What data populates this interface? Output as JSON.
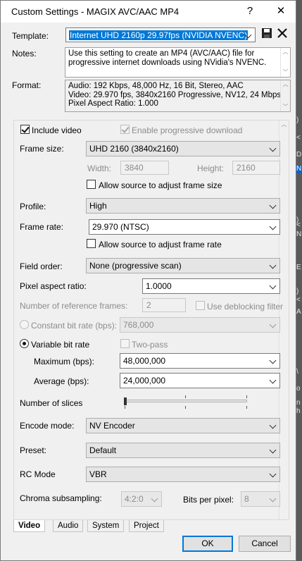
{
  "window": {
    "title": "Custom Settings - MAGIX AVC/AAC MP4",
    "help_glyph": "?",
    "close_glyph": "✕"
  },
  "template": {
    "label": "Template:",
    "value": "Internet UHD 2160p 29.97fps (NVIDIA NVENC)"
  },
  "notes": {
    "label": "Notes:",
    "text": "Use this setting to create an MP4 (AVC/AAC) file for progressive internet downloads using NVidia's NVENC."
  },
  "format": {
    "label": "Format:",
    "lines": [
      "Audio: 192 Kbps, 48,000 Hz, 16 Bit, Stereo, AAC",
      "Video: 29.970 fps, 3840x2160 Progressive, NV12, 24 Mbps",
      "Pixel Aspect Ratio: 1.000"
    ]
  },
  "video": {
    "include_video": "Include video",
    "enable_progressive": "Enable progressive download",
    "frame_size_label": "Frame size:",
    "frame_size": "UHD 2160 (3840x2160)",
    "width_label": "Width:",
    "width": "3840",
    "height_label": "Height:",
    "height": "2160",
    "allow_frame_size": "Allow source to adjust frame size",
    "profile_label": "Profile:",
    "profile": "High",
    "frame_rate_label": "Frame rate:",
    "frame_rate": "29.970 (NTSC)",
    "allow_frame_rate": "Allow source to adjust frame rate",
    "field_order_label": "Field order:",
    "field_order": "None (progressive scan)",
    "par_label": "Pixel aspect ratio:",
    "par": "1.0000",
    "ref_frames_label": "Number of reference frames:",
    "ref_frames": "2",
    "deblocking": "Use deblocking filter",
    "cbr_label": "Constant bit rate (bps):",
    "cbr": "768,000",
    "vbr_label": "Variable bit rate",
    "two_pass": "Two-pass",
    "max_label": "Maximum (bps):",
    "max": "48,000,000",
    "avg_label": "Average (bps):",
    "avg": "24,000,000",
    "slices_label": "Number of slices",
    "encode_label": "Encode mode:",
    "encode": "NV Encoder",
    "preset_label": "Preset:",
    "preset": "Default",
    "rc_label": "RC Mode",
    "rc": "VBR",
    "chroma_label": "Chroma subsampling:",
    "chroma": "4:2:0",
    "bpp_label": "Bits per pixel:",
    "bpp": "8"
  },
  "tabs": [
    "Video",
    "Audio",
    "System",
    "Project"
  ],
  "buttons": {
    "ok": "OK",
    "cancel": "Cancel"
  },
  "icons": {
    "save": "save-disk-icon",
    "delete": "delete-x-icon"
  },
  "colors": {
    "selection": "#0078d7",
    "accent_border": "#0078d7"
  },
  "background_strip": [
    ")",
    "<",
    "D",
    "N",
    ")",
    "<",
    "N",
    "E",
    ")",
    "<",
    "A",
    "\\",
    "o",
    "n",
    "h"
  ]
}
